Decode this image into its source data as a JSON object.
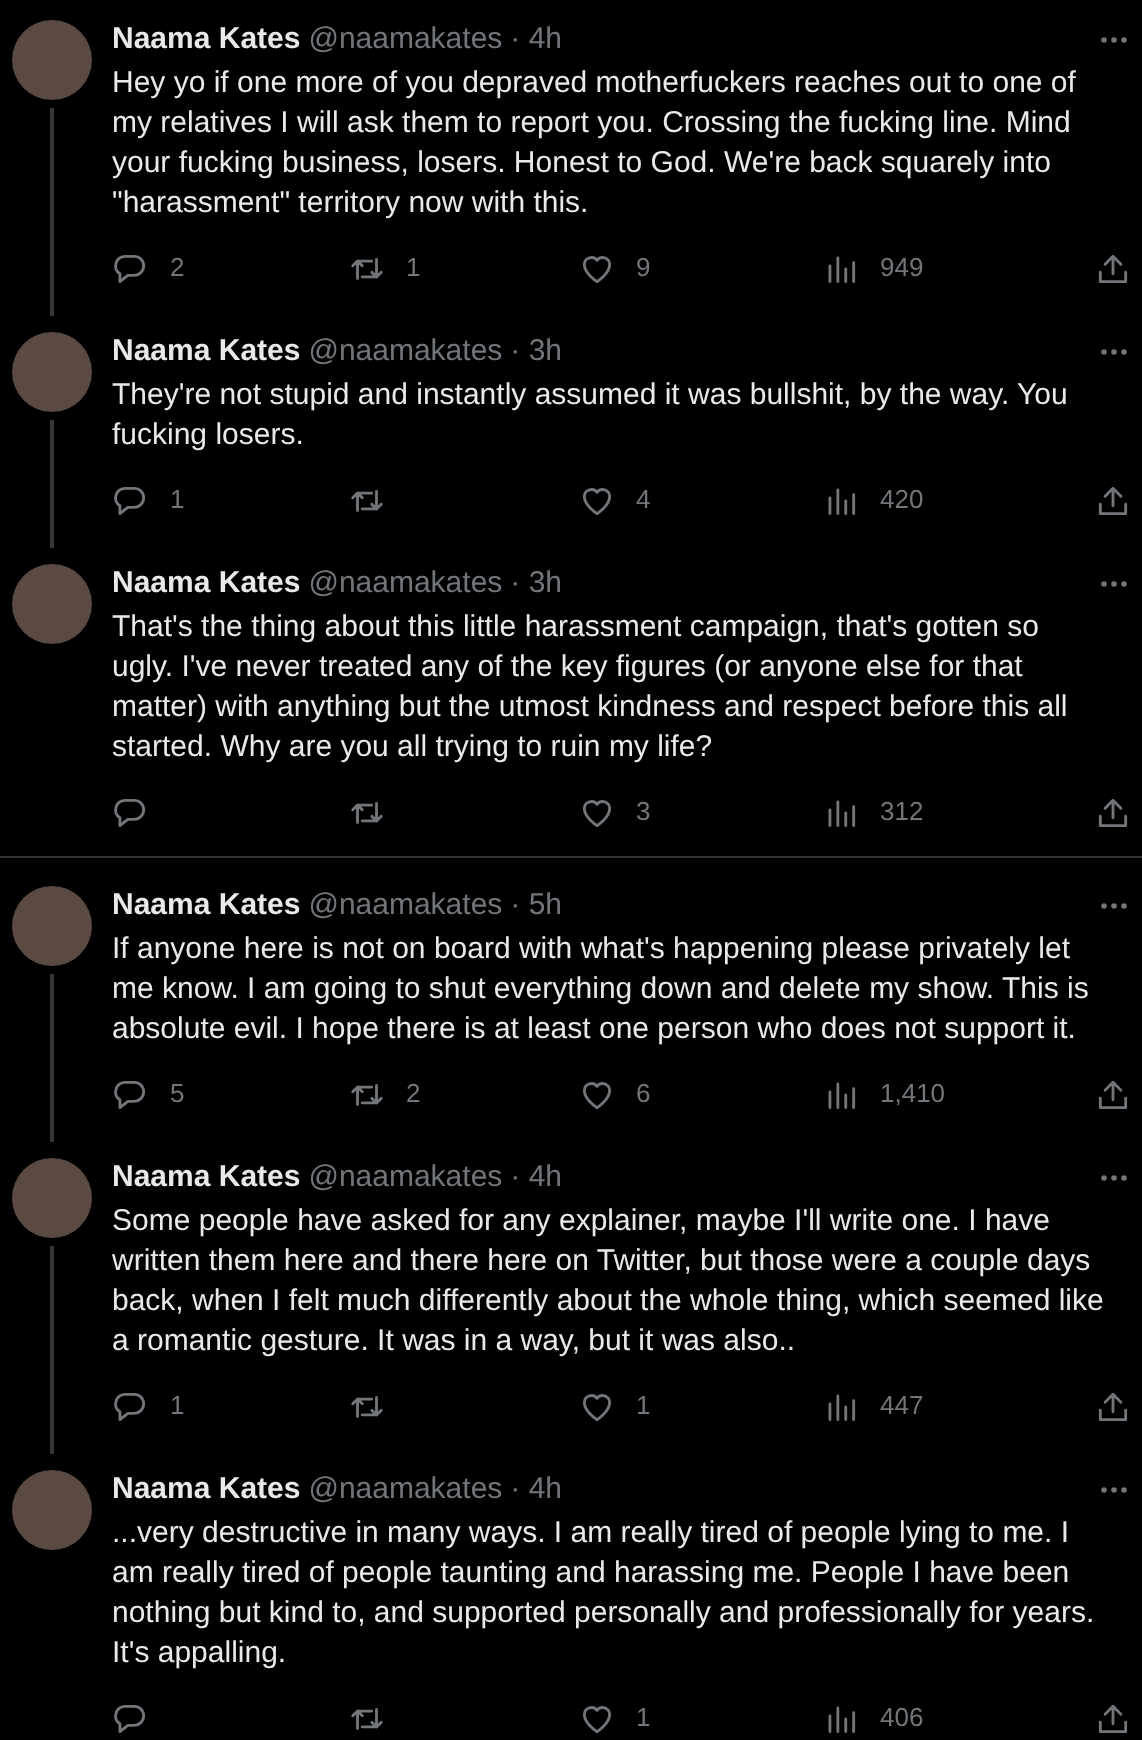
{
  "threads": [
    {
      "tweets": [
        {
          "name": "Naama Kates",
          "handle": "@naamakates",
          "time": "· 4h",
          "text": "Hey yo if one more of you depraved motherfuckers reaches out to one of my relatives I will ask them to report you. Crossing the fucking line. Mind your fucking business, losers. Honest to God. We're back squarely into \"harassment\" territory now with this.",
          "replies": "2",
          "reposts": "1",
          "likes": "9",
          "views": "949"
        },
        {
          "name": "Naama Kates",
          "handle": "@naamakates",
          "time": "· 3h",
          "text": "They're not stupid and instantly assumed it was bullshit, by the way. You fucking losers.",
          "replies": "1",
          "likes": "4",
          "views": "420"
        },
        {
          "name": "Naama Kates",
          "handle": "@naamakates",
          "time": "· 3h",
          "text": "That's the thing about this little harassment campaign, that's gotten so ugly. I've never treated any of the key figures (or anyone else for that matter) with anything but the utmost kindness and respect before this all started. Why are you all trying to ruin my life?",
          "likes": "3",
          "views": "312"
        }
      ]
    },
    {
      "tweets": [
        {
          "name": "Naama Kates",
          "handle": "@naamakates",
          "time": "· 5h",
          "text": "If anyone here is not on board with what's happening please privately let me know. I am going to shut everything down and delete my show. This is absolute evil. I hope there is at least one person who does not support it.",
          "replies": "5",
          "reposts": "2",
          "likes": "6",
          "views": "1,410"
        },
        {
          "name": "Naama Kates",
          "handle": "@naamakates",
          "time": "· 4h",
          "text": "Some people have asked for any explainer, maybe I'll write one. I have written them here and there here on Twitter, but those were a couple days back, when I felt much differently about the whole thing, which seemed like a romantic gesture. It was in a way, but it was also..",
          "replies": "1",
          "likes": "1",
          "views": "447"
        },
        {
          "name": "Naama Kates",
          "handle": "@naamakates",
          "time": "· 4h",
          "text": "...very destructive in many ways. I am really tired of people lying to me. I am really tired of people taunting and harassing me. People I have been nothing but kind to, and supported personally and professionally for years. It's appalling.",
          "likes": "1",
          "views": "406"
        }
      ]
    }
  ]
}
